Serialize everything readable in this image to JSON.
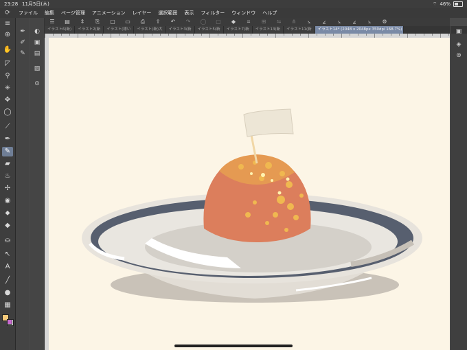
{
  "status": {
    "time": "23:28",
    "date": "11月5日(木)",
    "battery": "46%",
    "battery_level": 0.46
  },
  "menu": {
    "items": [
      "ファイル",
      "編集",
      "ページ管理",
      "アニメーション",
      "レイヤー",
      "選択範囲",
      "表示",
      "フィルター",
      "ウィンドウ",
      "ヘルプ"
    ]
  },
  "tabs": [
    {
      "label": "イラスト6(新)"
    },
    {
      "label": "イラスト2(新"
    },
    {
      "label": "イラスト(様い"
    },
    {
      "label": "イラスト(新)大"
    },
    {
      "label": "イラスト3(新"
    },
    {
      "label": "イラスト5(新"
    },
    {
      "label": "イラスト7(新"
    },
    {
      "label": "イラスト13(新"
    },
    {
      "label": "イラスト11(新"
    },
    {
      "label": "イラスト14* (2048 x 2048px 350dpi 168.7%)",
      "active": true
    }
  ],
  "colors": {
    "main_color": "#f3c97a",
    "sub_color": "#e6e6e6",
    "accent": "#7a8aa6"
  },
  "illustration": {
    "subject": "pudding-on-plate"
  }
}
